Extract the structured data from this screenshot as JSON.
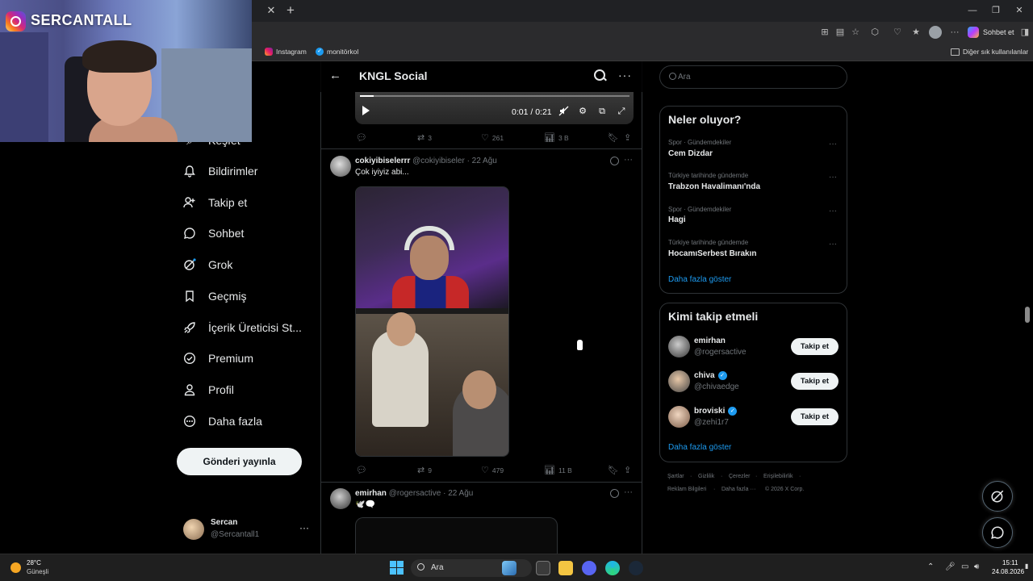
{
  "browser": {
    "bookmarks": [
      {
        "label": "Instagram",
        "icon": "instagram-icon"
      },
      {
        "label": "monitörkol",
        "icon": "verified-check-icon"
      }
    ],
    "other_bookmarks": "Diğer sık kullanılanlar",
    "copilot_label": "Sohbet et"
  },
  "overlay": {
    "channel_name": "SERCANTALL"
  },
  "nav": {
    "items": [
      {
        "label": "Keşfet",
        "icon": "search-icon"
      },
      {
        "label": "Bildirimler",
        "icon": "bell-icon"
      },
      {
        "label": "Takip et",
        "icon": "person-add-icon"
      },
      {
        "label": "Sohbet",
        "icon": "chat-bubble-icon"
      },
      {
        "label": "Grok",
        "icon": "grok-icon"
      },
      {
        "label": "Geçmiş",
        "icon": "bookmark-icon"
      },
      {
        "label": "İçerik Üreticisi St...",
        "icon": "rocket-icon"
      },
      {
        "label": "Premium",
        "icon": "verified-badge-icon"
      },
      {
        "label": "Profil",
        "icon": "person-icon"
      },
      {
        "label": "Daha fazla",
        "icon": "more-circle-icon"
      }
    ],
    "post_button": "Gönderi yayınla",
    "account": {
      "name": "Sercan",
      "handle": "@Sercantall1",
      "more": "···"
    }
  },
  "header": {
    "title": "KNGL Social"
  },
  "video": {
    "time": "0:01 / 0:21",
    "progress": 0.05
  },
  "posts": [
    {
      "actions": {
        "replies": "",
        "reposts": "3",
        "likes": "261",
        "views": "3 B"
      }
    },
    {
      "name": "cokiyibiselerrr",
      "handle": "@cokiyibiseler",
      "date": "· 22 Ağu",
      "text": "Çok iyiyiz abi...",
      "actions": {
        "replies": "",
        "reposts": "9",
        "likes": "479",
        "views": "11 B"
      }
    },
    {
      "name": "emirhan",
      "handle": "@rogersactive",
      "date": "· 22 Ağu",
      "text": "🕊️🗨️"
    }
  ],
  "sidebar": {
    "search_placeholder": "Ara",
    "trends_title": "Neler oluyor?",
    "trends": [
      {
        "category": "Spor · Gündemdekiler",
        "name": "Cem Dizdar"
      },
      {
        "category": "Türkiye tarihinde gündemde",
        "name": "Trabzon Havalimanı'nda"
      },
      {
        "category": "Spor · Gündemdekiler",
        "name": "Hagi"
      },
      {
        "category": "Türkiye tarihinde gündemde",
        "name": "HocamıSerbest Bırakın"
      }
    ],
    "show_more": "Daha fazla göster",
    "who_title": "Kimi takip etmeli",
    "who": [
      {
        "name": "emirhan",
        "handle": "@rogersactive",
        "verified": false,
        "button": "Takip et"
      },
      {
        "name": "chiva",
        "handle": "@chivaedge",
        "verified": true,
        "button": "Takip et"
      },
      {
        "name": "broviski",
        "handle": "@zehi1r7",
        "verified": true,
        "button": "Takip et"
      }
    ],
    "who_show_more": "Daha fazla göster",
    "footer": {
      "row1": [
        "Şartlar",
        "·",
        "Gizlilik",
        "·",
        "Çerezler",
        "·",
        "Erişilebilirlik",
        "·"
      ],
      "row2": [
        "Reklam Bilgileri",
        "·",
        "Daha fazla ···",
        "© 2026 X Corp."
      ]
    }
  },
  "taskbar": {
    "weather_temp": "28°C",
    "weather_desc": "Güneşli",
    "search_label": "Ara",
    "time": "15:11",
    "date": "24.08.2026"
  },
  "colors": {
    "accent": "#1d9bf0",
    "background": "#000000",
    "border": "#2f3336",
    "muted": "#71767b"
  }
}
